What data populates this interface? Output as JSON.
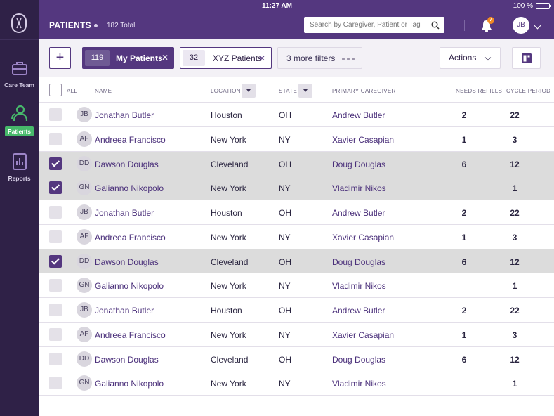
{
  "status_bar": {
    "time": "11:27 AM",
    "battery": "100 %"
  },
  "header": {
    "title": "PATIENTS",
    "total": "182 Total",
    "search_placeholder": "Search by Caregiver, Patient or Tag",
    "notification_count": "7",
    "user_initials": "JB"
  },
  "sidebar": {
    "items": [
      {
        "label": "Care Team",
        "icon": "briefcase-icon"
      },
      {
        "label": "Patients",
        "icon": "people-icon",
        "active": true
      },
      {
        "label": "Reports",
        "icon": "reports-icon"
      }
    ]
  },
  "toolbar": {
    "add_label": "+",
    "filters": [
      {
        "count": "119",
        "label": "My Patients"
      },
      {
        "count": "32",
        "label": "XYZ Patients"
      }
    ],
    "more_filters": "3 more filters",
    "actions": "Actions"
  },
  "table": {
    "headers": {
      "all": "ALL",
      "name": "NAME",
      "location": "LOCATION",
      "state": "STATE",
      "caregiver": "PRIMARY CAREGIVER",
      "refills": "NEEDS REFILLS",
      "cycle": "CYCLE PERIOD"
    },
    "rows": [
      {
        "initials": "JB",
        "name": "Jonathan Butler",
        "location": "Houston",
        "state": "OH",
        "caregiver": "Andrew Butler",
        "refills": "2",
        "cycle": "22",
        "checked": false
      },
      {
        "initials": "AF",
        "name": "Andreea Francisco",
        "location": "New York",
        "state": "NY",
        "caregiver": "Xavier Casapian",
        "refills": "1",
        "cycle": "3",
        "checked": false
      },
      {
        "initials": "DD",
        "name": "Dawson Douglas",
        "location": "Cleveland",
        "state": "OH",
        "caregiver": "Doug Douglas",
        "refills": "6",
        "cycle": "12",
        "checked": true
      },
      {
        "initials": "GN",
        "name": "Galianno Nikopolo",
        "location": "New York",
        "state": "NY",
        "caregiver": "Vladimir Nikos",
        "refills": "",
        "cycle": "1",
        "checked": true
      },
      {
        "initials": "JB",
        "name": "Jonathan Butler",
        "location": "Houston",
        "state": "OH",
        "caregiver": "Andrew Butler",
        "refills": "2",
        "cycle": "22",
        "checked": false
      },
      {
        "initials": "AF",
        "name": "Andreea Francisco",
        "location": "New York",
        "state": "NY",
        "caregiver": "Xavier Casapian",
        "refills": "1",
        "cycle": "3",
        "checked": false
      },
      {
        "initials": "DD",
        "name": "Dawson Douglas",
        "location": "Cleveland",
        "state": "OH",
        "caregiver": "Doug Douglas",
        "refills": "6",
        "cycle": "12",
        "checked": true
      },
      {
        "initials": "GN",
        "name": "Galianno Nikopolo",
        "location": "New York",
        "state": "NY",
        "caregiver": "Vladimir Nikos",
        "refills": "",
        "cycle": "1",
        "checked": false
      },
      {
        "initials": "JB",
        "name": "Jonathan Butler",
        "location": "Houston",
        "state": "OH",
        "caregiver": "Andrew Butler",
        "refills": "2",
        "cycle": "22",
        "checked": false
      },
      {
        "initials": "AF",
        "name": "Andreea Francisco",
        "location": "New York",
        "state": "NY",
        "caregiver": "Xavier Casapian",
        "refills": "1",
        "cycle": "3",
        "checked": false
      },
      {
        "initials": "DD",
        "name": "Dawson Douglas",
        "location": "Cleveland",
        "state": "OH",
        "caregiver": "Doug Douglas",
        "refills": "6",
        "cycle": "12",
        "checked": false
      },
      {
        "initials": "GN",
        "name": "Galianno Nikopolo",
        "location": "New York",
        "state": "NY",
        "caregiver": "Vladimir Nikos",
        "refills": "",
        "cycle": "1",
        "checked": false
      }
    ]
  },
  "colors": {
    "brand_purple": "#54377f",
    "sidebar": "#2f2147",
    "active_green": "#47b96b",
    "badge_orange": "#f08a24"
  }
}
